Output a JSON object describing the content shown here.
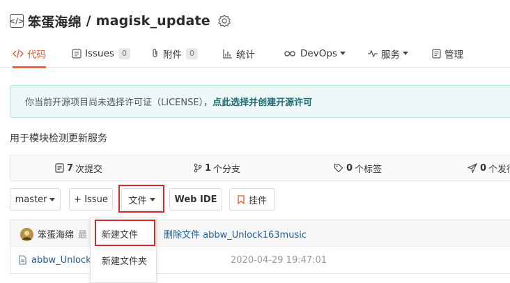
{
  "repo": {
    "owner": "笨蛋海绵",
    "separator": " / ",
    "name": "magisk_update"
  },
  "tabs": [
    {
      "label": "代码",
      "icon": "code-icon",
      "active": true
    },
    {
      "label": "Issues",
      "icon": "issues-icon",
      "count": "0"
    },
    {
      "label": "附件",
      "icon": "attachment-icon",
      "count": "0"
    },
    {
      "label": "统计",
      "icon": "stats-icon"
    },
    {
      "label": "DevOps",
      "icon": "devops-icon",
      "dropdown": true
    },
    {
      "label": "服务",
      "icon": "service-icon",
      "dropdown": true
    },
    {
      "label": "管理",
      "icon": "manage-icon"
    }
  ],
  "license": {
    "text": "你当前开源项目尚未选择许可证（LICENSE），",
    "link": "点此选择并创建开源许可"
  },
  "description": "用于模块检测更新服务",
  "stats": {
    "commits_count": "7",
    "commits_label": "次提交",
    "branches_count": "1",
    "branches_label": "个分支",
    "tags_count": "0",
    "tags_label": "个标签",
    "releases_count": "0",
    "releases_label": "个发行"
  },
  "toolbar": {
    "branch": "master",
    "issue": "+ Issue",
    "file": "文件",
    "webide": "Web IDE",
    "pin": "挂件"
  },
  "commit": {
    "author": "笨蛋海绵",
    "prefix": "最",
    "message": "删除文件 abbw_Unlock163music"
  },
  "file": {
    "name": "abbw_Unlock",
    "date": "2020-04-29 19:47:01"
  },
  "dropdown": {
    "items": [
      "新建文件",
      "新建文件夹"
    ]
  },
  "colors": {
    "accent": "#e45b2a",
    "highlight": "#d9262a",
    "link": "#1c6c74",
    "file_link": "#1f5c9a"
  }
}
